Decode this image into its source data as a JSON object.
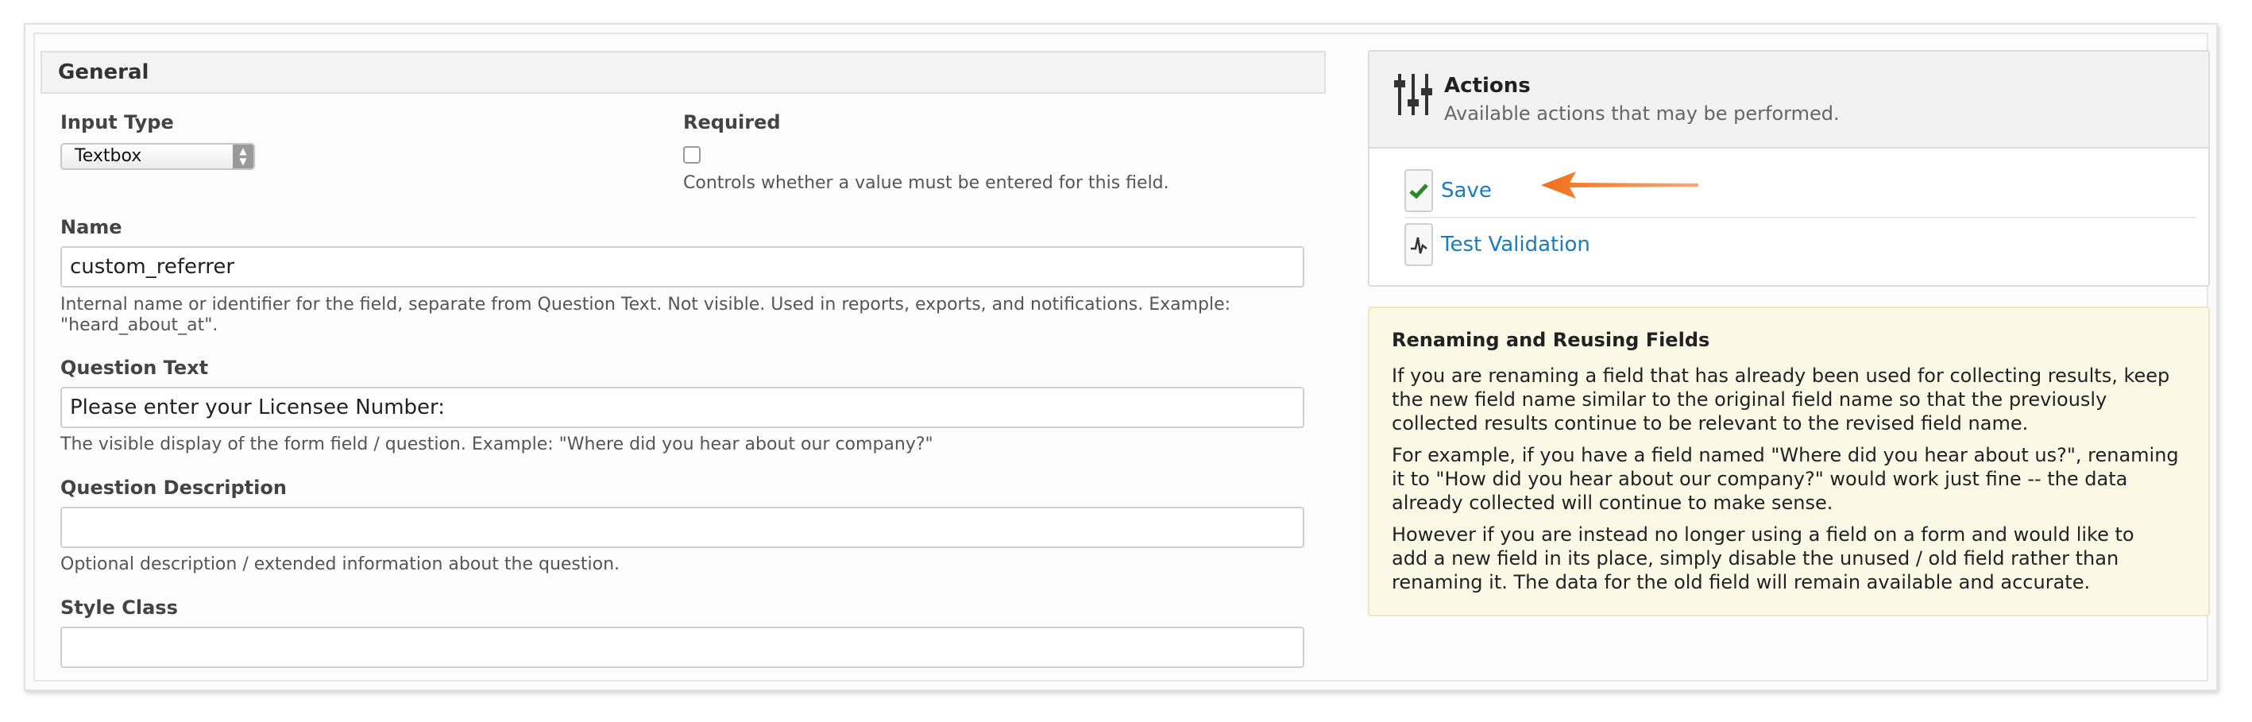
{
  "general": {
    "title": "General",
    "input_type": {
      "label": "Input Type",
      "value": "Textbox"
    },
    "required": {
      "label": "Required",
      "checked": false,
      "help": "Controls whether a value must be entered for this field."
    },
    "name": {
      "label": "Name",
      "value": "custom_referrer",
      "help_line1": "Internal name or identifier for the field, separate from Question Text. Not visible. Used in reports, exports, and notifications. Example:",
      "help_line2": "\"heard_about_at\"."
    },
    "question_text": {
      "label": "Question Text",
      "value": "Please enter your Licensee Number:",
      "help": "The visible display of the form field / question. Example: \"Where did you hear about our company?\""
    },
    "question_description": {
      "label": "Question Description",
      "value": "",
      "help": "Optional description / extended information about the question."
    },
    "style_class": {
      "label": "Style Class",
      "value": ""
    }
  },
  "actions": {
    "title": "Actions",
    "subtitle": "Available actions that may be performed.",
    "icon": "sliders-icon",
    "items": [
      {
        "label": "Save",
        "icon": "checkmark-icon",
        "icon_color": "#2a8a2a"
      },
      {
        "label": "Test Validation",
        "icon": "pulse-icon",
        "icon_color": "#333333"
      }
    ],
    "annotation_arrow_color": "#f0701a"
  },
  "info": {
    "title": "Renaming and Reusing Fields",
    "p1_l1": "If you are renaming a field that has already been used for collecting results, keep",
    "p1_l2": "the new field name similar to the original field name so that the previously",
    "p1_l3": "collected results continue to be relevant to the revised field name.",
    "p2_l1": "For example, if you have a field named \"Where did you hear about us?\", renaming",
    "p2_l2": "it to \"How did you hear about our company?\" would work just fine -- the data",
    "p2_l3": "already collected will continue to make sense.",
    "p3_l1": "However if you are instead no longer using a field on a form and would like to",
    "p3_l2": "add a new field in its place, simply disable the unused / old field rather than",
    "p3_l3": "renaming it. The data for the old field will remain available and accurate."
  }
}
